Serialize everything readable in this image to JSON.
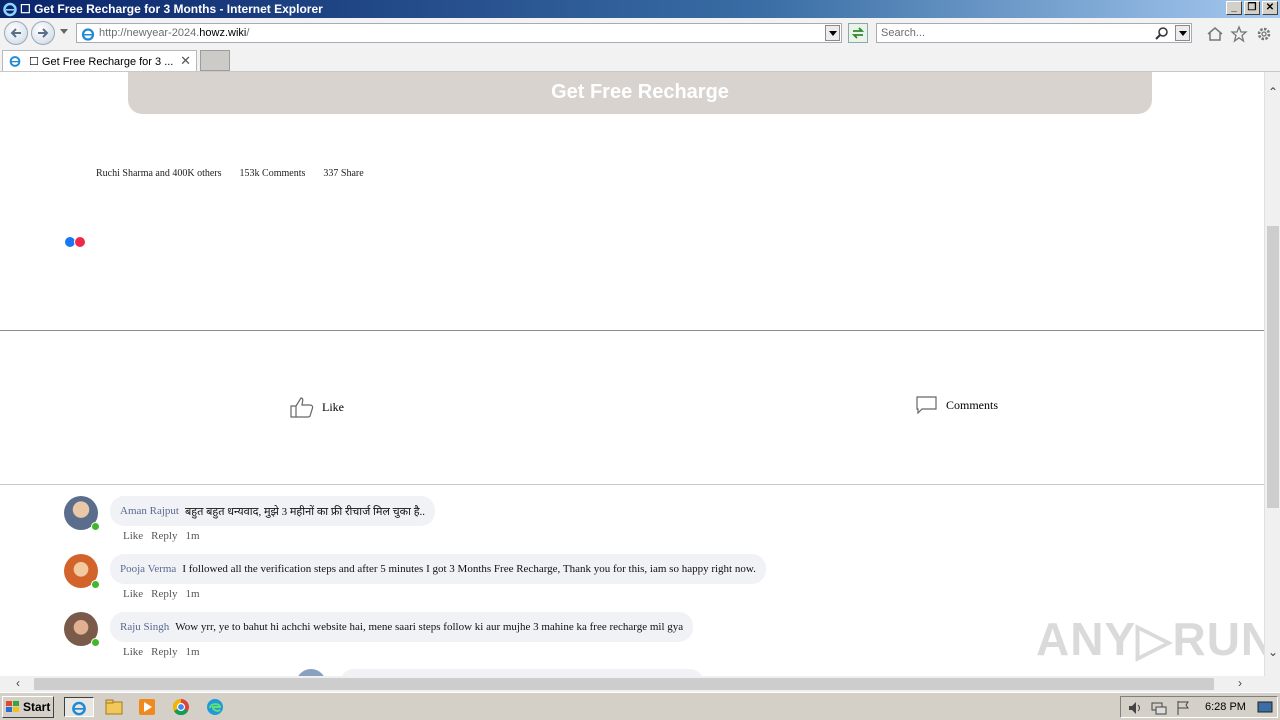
{
  "window": {
    "title": "☐ Get Free Recharge for 3 Months - Internet Explorer",
    "controls": [
      "_",
      "❐",
      "✕"
    ]
  },
  "navbar": {
    "url_prefix": "http://newyear-2024.",
    "url_domain": "howz.wiki",
    "url_suffix": "/",
    "search_placeholder": "Search..."
  },
  "tabs": [
    {
      "label": "☐ Get Free Recharge for 3 ...",
      "close": "✕"
    }
  ],
  "page": {
    "cta_label": "Get Free Recharge",
    "stats": {
      "likes": "Ruchi Sharma and 400K others",
      "comments": "153k  Comments",
      "shares": "337  Share"
    },
    "actions": {
      "like": "Like",
      "comments": "Comments"
    },
    "comments": [
      {
        "name": "Aman Rajput",
        "text": "बहुत बहुत धन्यवाद, मुझे 3 महीनों का फ्री रीचार्ज मिल चुका है..",
        "like": "Like",
        "reply": "Reply",
        "time": "1m",
        "avatar_color": "#5a6e8c"
      },
      {
        "name": "Pooja Verma",
        "text": "I followed all the verification steps and after 5 minutes I got 3 Months Free Recharge, Thank you for this, iam so happy right now.",
        "like": "Like",
        "reply": "Reply",
        "time": "1m",
        "avatar_color": "#d2632a"
      },
      {
        "name": "Raju Singh",
        "text": "Wow yrr, ye to bahut hi achchi website hai, mene saari steps follow ki aur mujhe 3 mahine ka free recharge mil gya",
        "like": "Like",
        "reply": "Reply",
        "time": "1m",
        "avatar_color": "#7a5a48"
      }
    ],
    "watermark": "ANY▷RUN"
  },
  "taskbar": {
    "start_label": "Start",
    "clock": "6:28 PM"
  },
  "colors": {
    "cta_bg": "#d8d3cf",
    "comment_name": "#5b6a92",
    "online": "#42b72a"
  }
}
